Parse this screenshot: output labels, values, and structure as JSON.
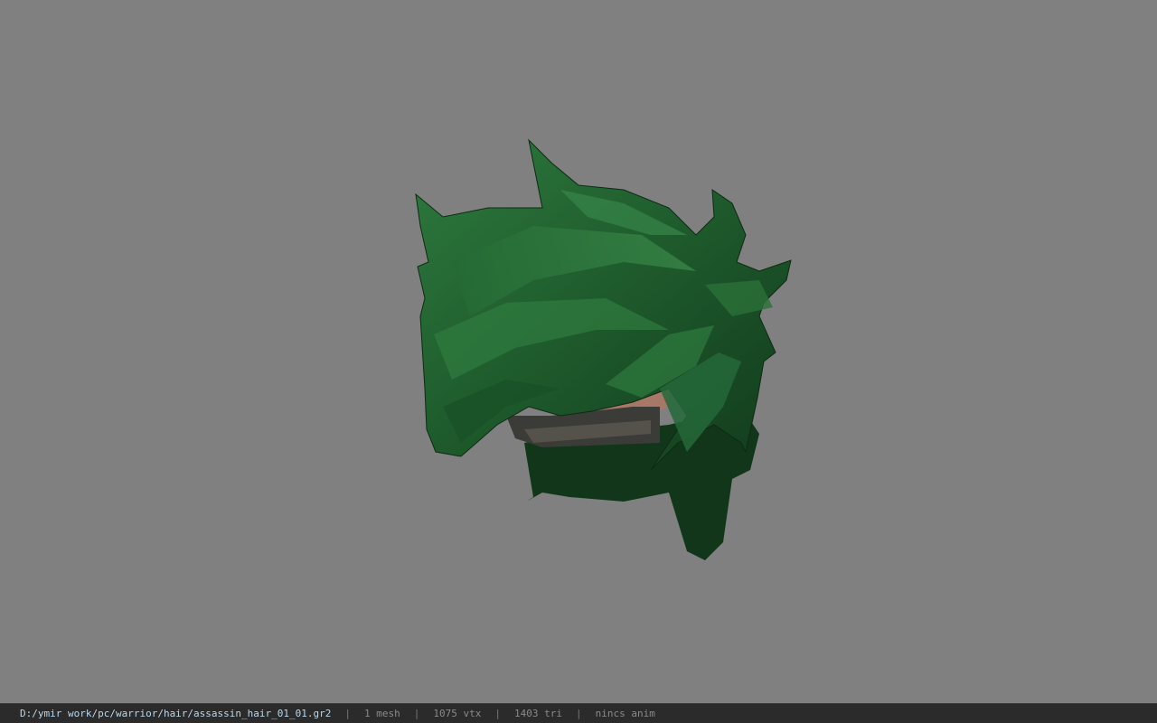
{
  "viewer": {
    "background_color": "#808080",
    "model_icon": "hair-mesh",
    "hair_color": "#1f5a2c",
    "skin_color": "#a87866"
  },
  "status": {
    "path": "D:/ymir work/pc/warrior/hair/assassin_hair_01_01.gr2",
    "separator": "|",
    "mesh": "1 mesh",
    "vertices": "1075 vtx",
    "triangles": "1403 tri",
    "anim": "nincs anim"
  }
}
